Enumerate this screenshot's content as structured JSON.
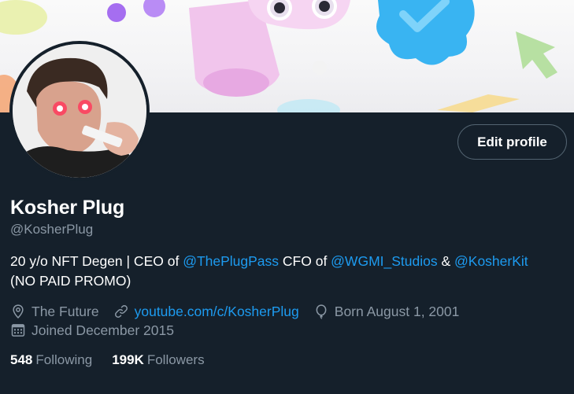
{
  "profile": {
    "display_name": "Kosher Plug",
    "handle": "@KosherPlug",
    "edit_button": "Edit profile"
  },
  "bio": {
    "part1": "20 y/o NFT Degen | CEO of ",
    "link1": "@ThePlugPass",
    "part2": " CFO of ",
    "link2": "@WGMI_Studios",
    "part3": " & ",
    "link3": "@KosherKit",
    "part4": "(NO PAID PROMO)"
  },
  "meta": {
    "location": "The Future",
    "website": "youtube.com/c/KosherPlug",
    "birthday": "Born August 1, 2001",
    "joined": "Joined December 2015"
  },
  "stats": {
    "following_count": "548",
    "following_label": "Following",
    "followers_count": "199K",
    "followers_label": "Followers"
  },
  "icons": [
    "location-pin-icon",
    "link-icon",
    "balloon-icon",
    "calendar-icon"
  ],
  "colors": {
    "background": "#15202b",
    "link": "#1d9bf0",
    "secondary_text": "#8b98a5",
    "button_border": "#536471"
  }
}
